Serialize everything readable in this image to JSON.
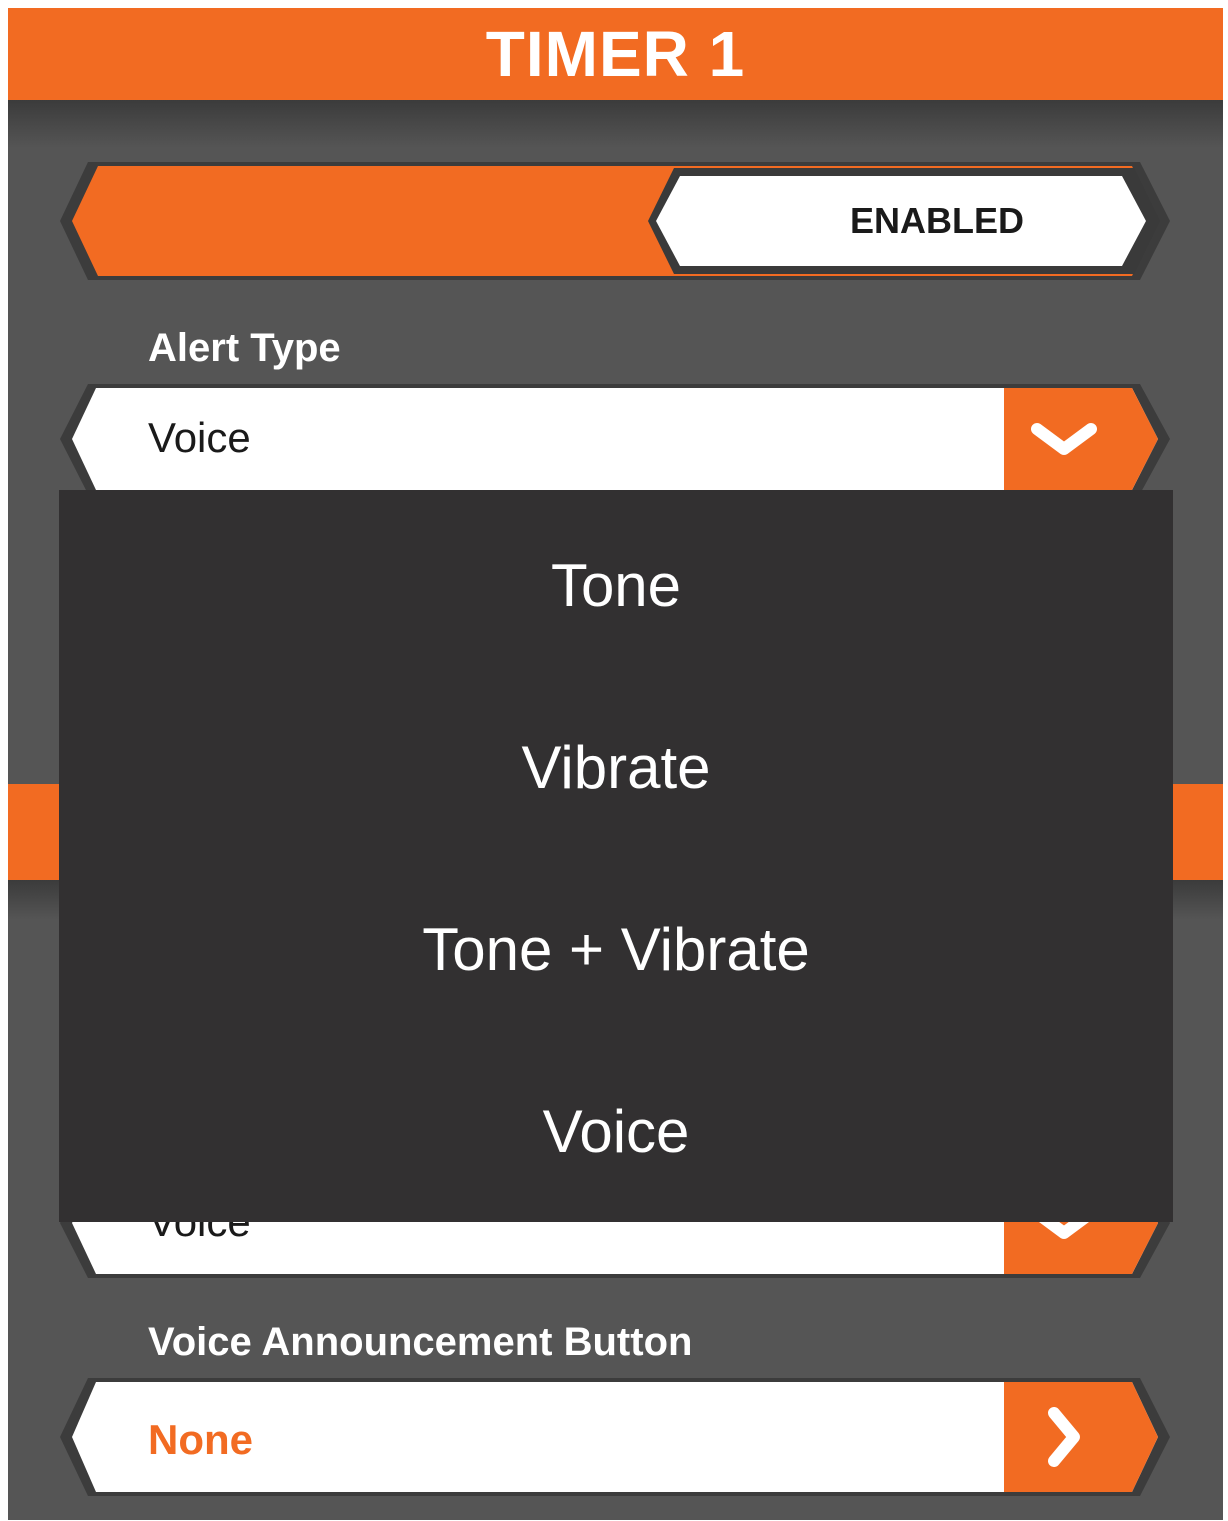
{
  "header": {
    "title": "TIMER 1"
  },
  "toggle": {
    "state": "ENABLED"
  },
  "alert_type": {
    "label": "Alert Type",
    "value": "Voice",
    "button_icon": "chevron-down-icon"
  },
  "alert_type_menu": {
    "options": [
      "Tone",
      "Vibrate",
      "Tone + Vibrate",
      "Voice"
    ]
  },
  "hidden_field": {
    "value_partial": "Voice",
    "button_icon": "chevron-down-icon"
  },
  "voice_announcement": {
    "label": "Voice Announcement Button",
    "value": "None",
    "button_icon": "chevron-right-icon"
  },
  "colors": {
    "accent": "#f26b22",
    "background": "#555555",
    "menu": "#323031",
    "field": "#ffffff"
  }
}
